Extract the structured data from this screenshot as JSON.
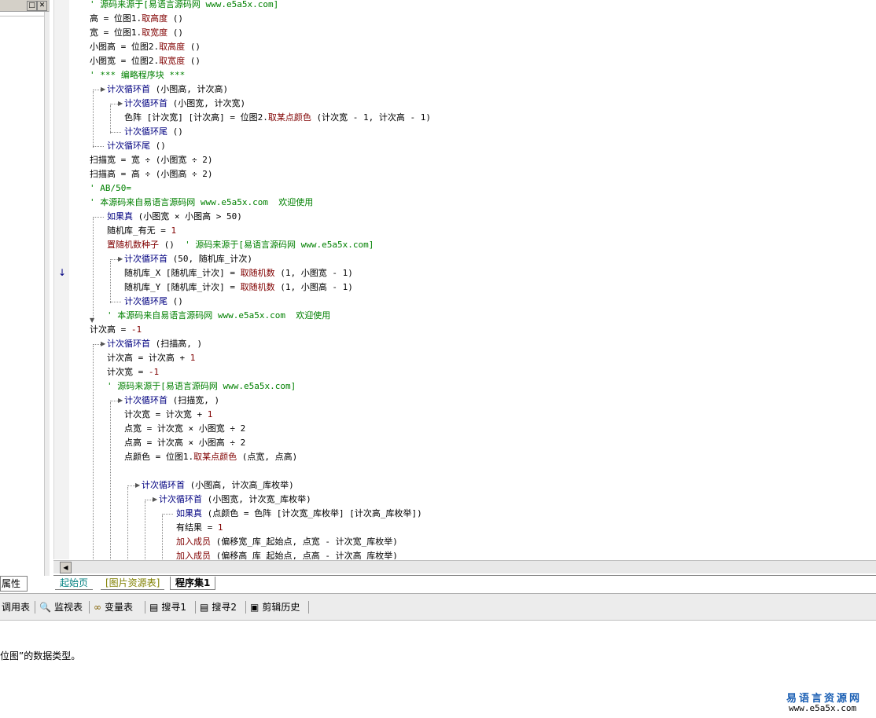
{
  "left_panel": {
    "title_buttons": [
      "□",
      "✕"
    ]
  },
  "property_tab": "属性",
  "tabs": [
    {
      "label": "起始页"
    },
    {
      "label": "[图片资源表]"
    },
    {
      "label": "程序集1"
    }
  ],
  "bottom_tabs": [
    {
      "label": "调用表",
      "icon": "call-list-icon"
    },
    {
      "label": "监视表",
      "icon": "magnifier-icon"
    },
    {
      "label": "变量表",
      "icon": "variables-icon"
    },
    {
      "label": "搜寻1",
      "icon": "find-icon"
    },
    {
      "label": "搜寻2",
      "icon": "find-icon"
    },
    {
      "label": "剪辑历史",
      "icon": "clipboard-history-icon"
    }
  ],
  "status_text": "位图”的数据类型。",
  "brand": {
    "name": "易语言资源网",
    "url": "www.e5a5x.com"
  },
  "code": {
    "l01": "' 源码来源于[易语言源码网 www.e5a5x.com]",
    "l02a": "高 = 位图1.",
    "l02b": "取高度",
    "l02c": " ()",
    "l03a": "宽 = 位图1.",
    "l03b": "取宽度",
    "l03c": " ()",
    "l04a": "小图高 = 位图2.",
    "l04b": "取高度",
    "l04c": " ()",
    "l05a": "小图宽 = 位图2.",
    "l05b": "取宽度",
    "l05c": " ()",
    "l06": "' *** 编略程序块 ***",
    "l07a": "计次循环首",
    "l07b": " (小图高, 计次高)",
    "l08a": "计次循环首",
    "l08b": " (小图宽, 计次宽)",
    "l09a": "色阵 [计次宽] [计次高] = 位图2.",
    "l09b": "取某点颜色",
    "l09c": " (计次宽 - 1, 计次高 - 1)",
    "l10a": "计次循环尾",
    "l10b": " ()",
    "l11a": "计次循环尾",
    "l11b": " ()",
    "l12": "扫描宽 = 宽 ÷ (小图宽 ÷ 2)",
    "l13": "扫描高 = 高 ÷ (小图高 ÷ 2)",
    "l14": "' AB/50=",
    "l15": "' 本源码来自易语言源码网 www.e5a5x.com  欢迎使用",
    "l16a": "如果真",
    "l16b": " (小图宽 × 小图高 > 50)",
    "l17a": "随机库_有无 = ",
    "l17b": "1",
    "l18a": "置随机数种子",
    "l18b": " () ",
    "l18c": " ' 源码来源于[易语言源码网 www.e5a5x.com]",
    "l19a": "计次循环首",
    "l19b": " (50, 随机库_计次)",
    "l20a": "随机库_X [随机库_计次] = ",
    "l20b": "取随机数",
    "l20c": " (1, 小图宽 - 1)",
    "l21a": "随机库_Y [随机库_计次] = ",
    "l21b": "取随机数",
    "l21c": " (1, 小图高 - 1)",
    "l22a": "计次循环尾",
    "l22b": " ()",
    "l23": "' 本源码来自易语言源码网 www.e5a5x.com  欢迎使用",
    "l24a": "计次高 = ",
    "l24b": "-1",
    "l25a": "计次循环首",
    "l25b": " (扫描高, )",
    "l26a": "计次高 = 计次高 + ",
    "l26b": "1",
    "l27a": "计次宽 = ",
    "l27b": "-1",
    "l28": "' 源码来源于[易语言源码网 www.e5a5x.com]",
    "l29a": "计次循环首",
    "l29b": " (扫描宽, )",
    "l30a": "计次宽 = 计次宽 + ",
    "l30b": "1",
    "l31": "点宽 = 计次宽 × 小图宽 ÷ 2",
    "l32": "点高 = 计次高 × 小图高 ÷ 2",
    "l33a": "点颜色 = 位图1.",
    "l33b": "取某点颜色",
    "l33c": " (点宽, 点高)",
    "l34a": "计次循环首",
    "l34b": " (小图高, 计次高_库枚举)",
    "l35a": "计次循环首",
    "l35b": " (小图宽, 计次宽_库枚举)",
    "l36a": "如果真",
    "l36b": " (点颜色 = 色阵 [计次宽_库枚举] [计次高_库枚举])",
    "l37a": "有结果 = ",
    "l37b": "1",
    "l38a": "加入成员",
    "l38b": " (偏移宽_库_起始点, 点宽 - 计次宽_库枚举)",
    "l39a": "加入成员",
    "l39b": " (偏移高_库_起始点, 点高 - 计次高_库枚举)"
  }
}
